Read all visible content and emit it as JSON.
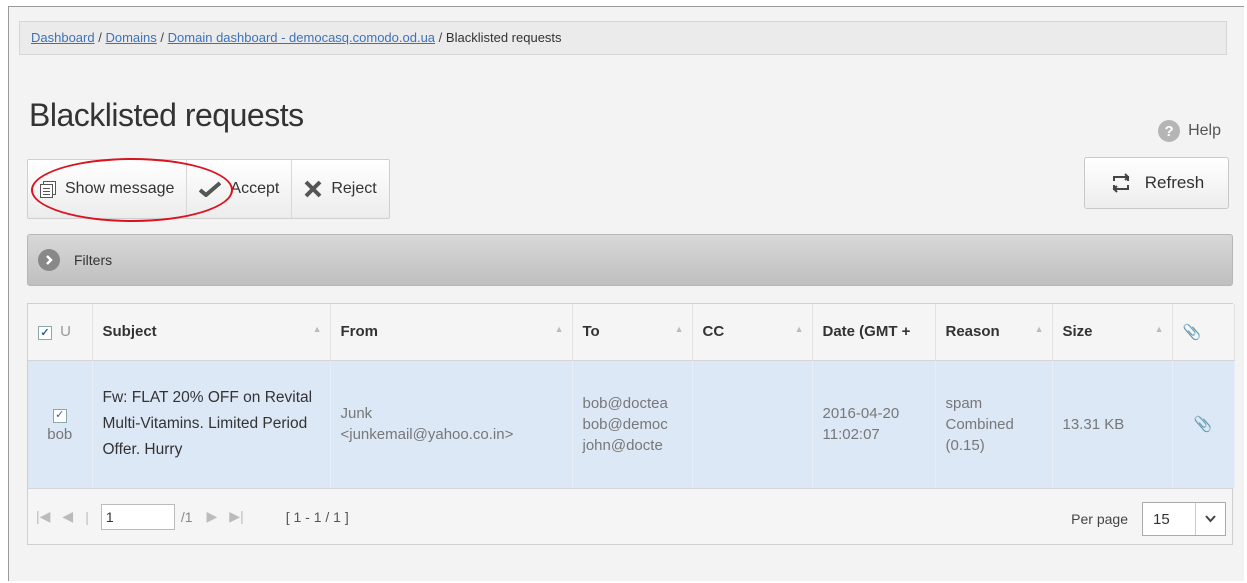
{
  "breadcrumb": {
    "items": [
      "Dashboard",
      "Domains",
      "Domain dashboard - democasq.comodo.od.ua"
    ],
    "current": "Blacklisted requests",
    "separator": "/"
  },
  "page": {
    "title": "Blacklisted requests"
  },
  "help": {
    "label": "Help"
  },
  "toolbar": {
    "show_message": "Show message",
    "accept": "Accept",
    "reject": "Reject",
    "refresh": "Refresh"
  },
  "filters": {
    "label": "Filters"
  },
  "table": {
    "columns": [
      "Subject",
      "From",
      "To",
      "CC",
      "Date (GMT +",
      "Reason",
      "Size"
    ],
    "first_col_header": "U",
    "rows": [
      {
        "checked": true,
        "user": "bob",
        "subject": "Fw: FLAT 20% OFF on Revital Multi-Vitamins. Limited Period Offer. Hurry",
        "from_name": "Junk",
        "from_email": "<junkemail@yahoo.co.in>",
        "to": [
          "bob@doctea",
          "bob@democ",
          "john@docte"
        ],
        "cc": "",
        "date": "2016-04-20",
        "time": "11:02:07",
        "reason": [
          "spam",
          "Combined",
          "(0.15)"
        ],
        "size": "13.31 KB"
      }
    ]
  },
  "pager": {
    "page": "1",
    "total_pages": "/1",
    "range": "[ 1 - 1 / 1 ]",
    "per_page_label": "Per page",
    "per_page_value": "15"
  },
  "colors": {
    "highlight": "#d9141f",
    "link": "#3d72b8",
    "row_bg": "#dde8f7"
  }
}
